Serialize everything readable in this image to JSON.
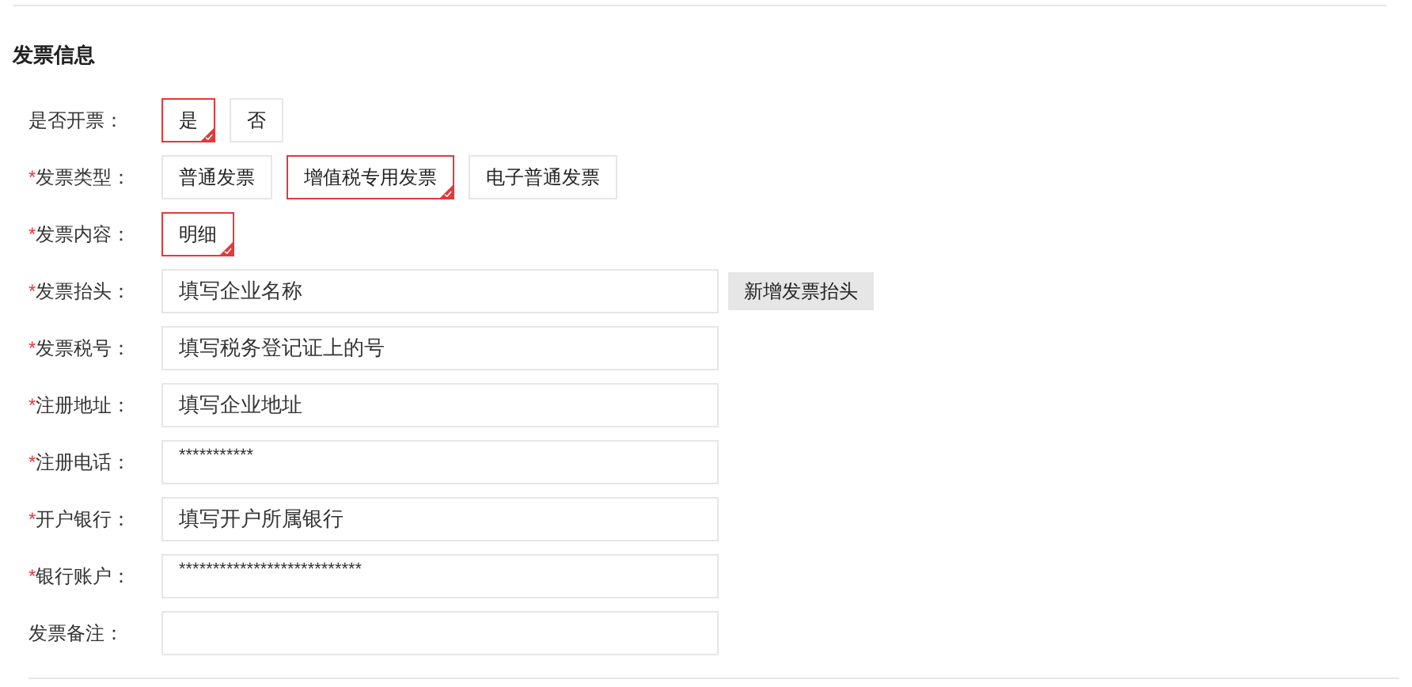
{
  "section": {
    "title": "发票信息"
  },
  "rows": [
    {
      "kind": "options",
      "label": "是否开票：",
      "options": [
        {
          "label": "是",
          "selected": true
        },
        {
          "label": "否",
          "selected": false
        }
      ]
    },
    {
      "kind": "options",
      "required_mark": "*",
      "label": "发票类型：",
      "options": [
        {
          "label": "普通发票",
          "selected": false
        },
        {
          "label": "增值税专用发票",
          "selected": true
        },
        {
          "label": "电子普通发票",
          "selected": false
        }
      ]
    },
    {
      "kind": "options",
      "required_mark": "*",
      "label": "发票内容：",
      "options": [
        {
          "label": "明细",
          "selected": true
        }
      ]
    },
    {
      "kind": "input",
      "required_mark": "*",
      "label": "发票抬头：",
      "value": "填写企业名称",
      "button": "新增发票抬头"
    },
    {
      "kind": "input",
      "required_mark": "*",
      "label": "发票税号：",
      "value": "填写税务登记证上的号"
    },
    {
      "kind": "input",
      "required_mark": "*",
      "label": "注册地址：",
      "value": "填写企业地址"
    },
    {
      "kind": "input",
      "required_mark": "*",
      "label": "注册电话：",
      "value": "***********",
      "masked": true
    },
    {
      "kind": "input",
      "required_mark": "*",
      "label": "开户银行：",
      "value": "填写开户所属银行"
    },
    {
      "kind": "input",
      "required_mark": "*",
      "label": "银行账户：",
      "value": "***************************",
      "masked": true
    },
    {
      "kind": "input",
      "label": "发票备注："
    }
  ]
}
